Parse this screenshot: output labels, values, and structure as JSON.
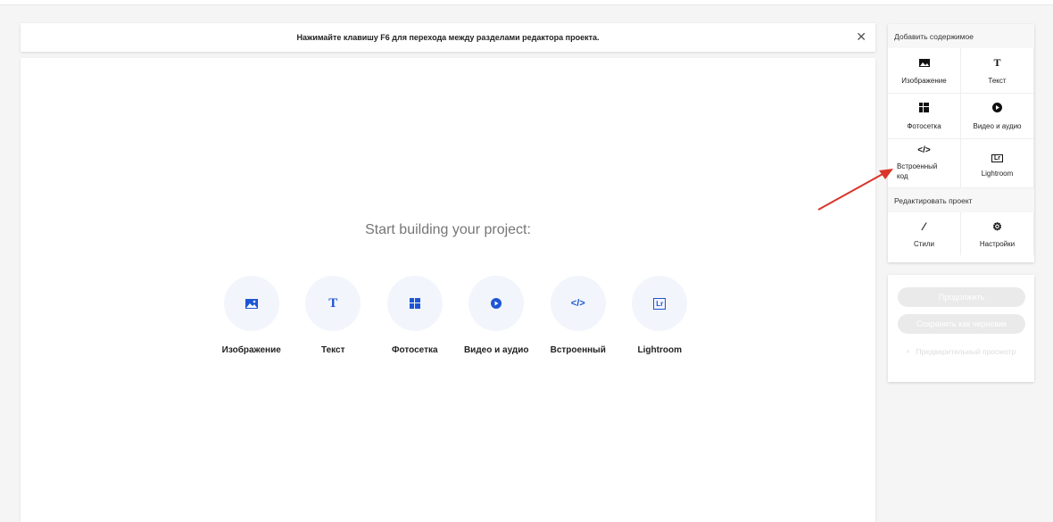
{
  "notice": {
    "text": "Нажимайте клавишу F6 для перехода между разделами редактора проекта.",
    "close": "✕"
  },
  "canvas": {
    "title": "Start building your project:",
    "tiles": [
      {
        "label": "Изображение",
        "icon": "image-icon"
      },
      {
        "label": "Текст",
        "icon": "text-icon"
      },
      {
        "label": "Фотосетка",
        "icon": "grid-icon"
      },
      {
        "label": "Видео и аудио",
        "icon": "play-icon"
      },
      {
        "label": "Встроенный",
        "icon": "code-icon"
      },
      {
        "label": "Lightroom",
        "icon": "lightroom-icon"
      }
    ]
  },
  "sidebar": {
    "add_heading": "Добавить содержимое",
    "add_items": [
      "Изображение",
      "Текст",
      "Фотосетка",
      "Видео и аудио",
      "Встроенный код",
      "Lightroom"
    ],
    "edit_heading": "Редактировать проект",
    "edit_items": [
      "Стили",
      "Настройки"
    ],
    "continue": "Продолжить",
    "save_draft": "Сохранить как черновик",
    "preview": "Предварительный просмотр"
  },
  "colors": {
    "accent": "#1d56d4",
    "arrow": "#d9352a"
  }
}
